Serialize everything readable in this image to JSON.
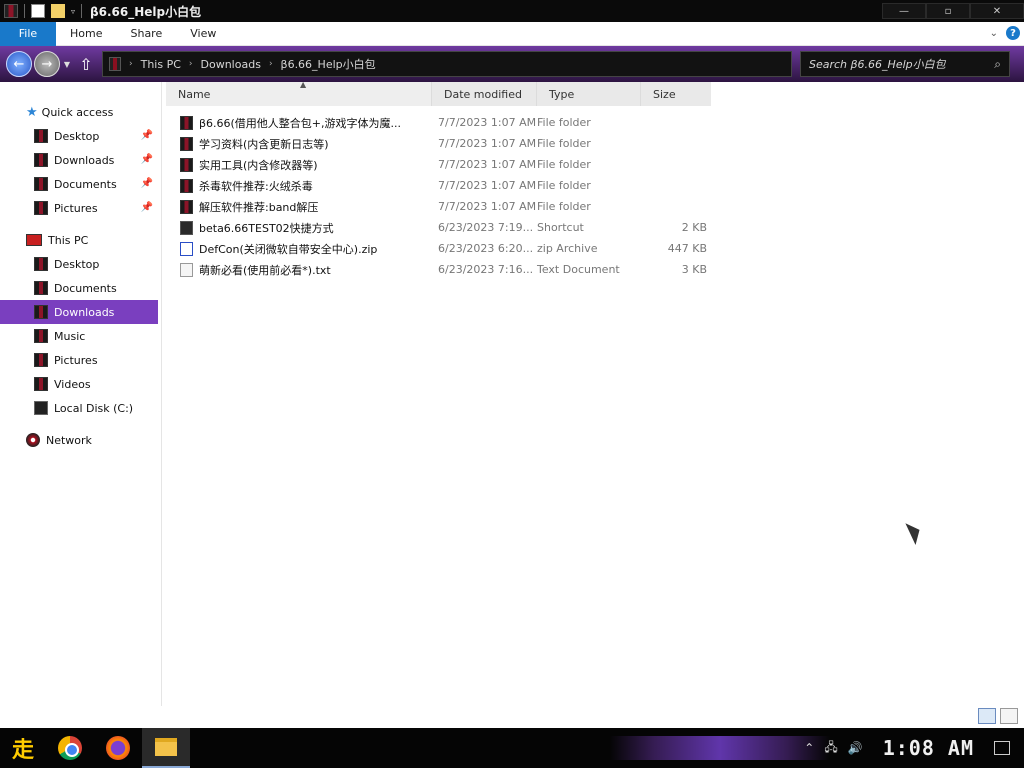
{
  "window": {
    "title": "β6.66_Help小白包"
  },
  "ribbon": {
    "tabs": [
      "File",
      "Home",
      "Share",
      "View"
    ]
  },
  "address": {
    "crumbs": [
      "This PC",
      "Downloads",
      "β6.66_Help小白包"
    ],
    "search_placeholder": "Search β6.66_Help小白包"
  },
  "sidebar": {
    "quick_access": "Quick access",
    "quick_items": [
      "Desktop",
      "Downloads",
      "Documents",
      "Pictures"
    ],
    "this_pc": "This PC",
    "pc_items": [
      "Desktop",
      "Documents",
      "Downloads",
      "Music",
      "Pictures",
      "Videos",
      "Local Disk (C:)"
    ],
    "network": "Network",
    "selected": "Downloads"
  },
  "columns": {
    "name": "Name",
    "date": "Date modified",
    "type": "Type",
    "size": "Size"
  },
  "files": [
    {
      "name": "β6.66(借用他人整合包+,游戏字体为魔...",
      "date": "7/7/2023 1:07 AM",
      "type": "File folder",
      "size": "",
      "icon": "folder-icon"
    },
    {
      "name": "学习资料(内含更新日志等)",
      "date": "7/7/2023 1:07 AM",
      "type": "File folder",
      "size": "",
      "icon": "folder-icon"
    },
    {
      "name": "实用工具(内含修改器等)",
      "date": "7/7/2023 1:07 AM",
      "type": "File folder",
      "size": "",
      "icon": "folder-icon"
    },
    {
      "name": "杀毒软件推荐:火绒杀毒",
      "date": "7/7/2023 1:07 AM",
      "type": "File folder",
      "size": "",
      "icon": "folder-icon"
    },
    {
      "name": "解压软件推荐:band解压",
      "date": "7/7/2023 1:07 AM",
      "type": "File folder",
      "size": "",
      "icon": "folder-icon"
    },
    {
      "name": "beta6.66TEST02快捷方式",
      "date": "6/23/2023 7:19...",
      "type": "Shortcut",
      "size": "2 KB",
      "icon": "shortcut-icon"
    },
    {
      "name": "DefCon(关闭微软自带安全中心).zip",
      "date": "6/23/2023 6:20...",
      "type": "zip Archive",
      "size": "447 KB",
      "icon": "zip-icon"
    },
    {
      "name": "萌新必看(使用前必看*).txt",
      "date": "6/23/2023 7:16...",
      "type": "Text Document",
      "size": "3 KB",
      "icon": "txt-icon"
    }
  ],
  "taskbar": {
    "clock": "1:08 AM",
    "start_glyph": "走"
  }
}
